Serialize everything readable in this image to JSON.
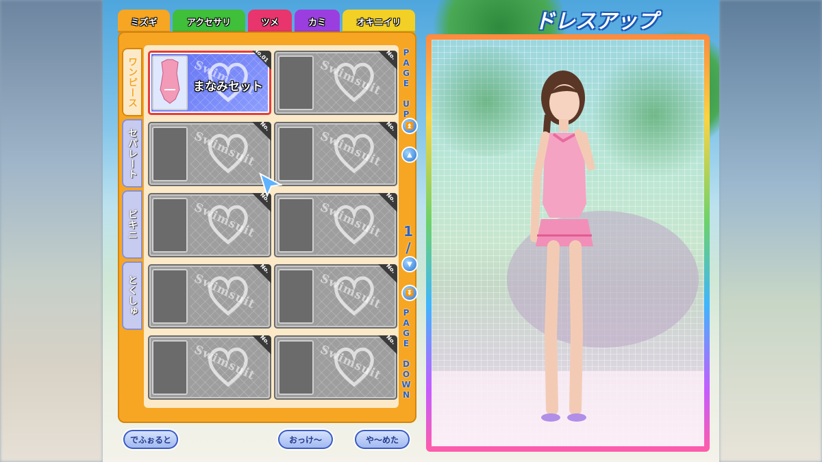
{
  "tabs": [
    {
      "label": "ミズギ",
      "color": "#f6a623"
    },
    {
      "label": "アクセサリ",
      "color": "#3fbf3a"
    },
    {
      "label": "ツメ",
      "color": "#e8356d"
    },
    {
      "label": "カミ",
      "color": "#9b3ee0"
    },
    {
      "label": "オキニイリ",
      "color": "#f2d025"
    }
  ],
  "categories": [
    "ワンピース",
    "セパレート",
    "ビキニ",
    "とくしゅ"
  ],
  "slots": {
    "selected": {
      "badge": "No.01",
      "name": "まなみセット",
      "watermark": "Swimsuit"
    },
    "empty": {
      "badge": "No.",
      "watermark": "Swimsuit"
    }
  },
  "pager": {
    "page_up": "PAGE UP",
    "page_down": "PAGE DOWN",
    "page_indicator": "1/3"
  },
  "buttons": {
    "default": "でふぉると",
    "ok": "おっけ～",
    "cancel": "や～めた"
  },
  "title": "ドレスアップ"
}
